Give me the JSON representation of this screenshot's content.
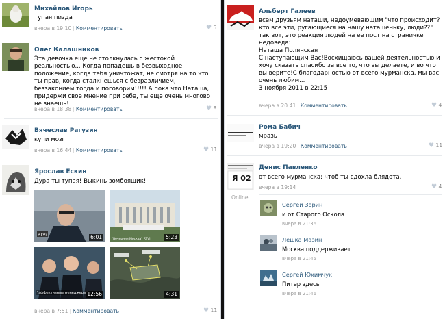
{
  "left": {
    "posts": [
      {
        "author": "Михайлов Игорь",
        "text": "тупая пизда",
        "time": "вчера в 19:10",
        "comment": "Комментировать",
        "likes": "5"
      },
      {
        "author": "Олег Калашников",
        "text": "Эта девочка еще не столкнулась с жестокой реальностью... Когда попадешь в безвыходное положение, когда тебя уничтожат, не смотря на то что ты прав, когда сталкнешься с безразличием, беззаконием тогда и поговорим!!!!! А пока что Наташа, придержи свое мнение при себе, ты еще очень многово не знаешь!",
        "time": "вчера в 18:38",
        "comment": "Комментировать",
        "likes": "8"
      },
      {
        "author": "Вячеслав Рагузин",
        "text": "купи мозг",
        "time": "вчера в 16:44",
        "comment": "Комментировать",
        "likes": "11"
      },
      {
        "author": "Ярослав Ескин",
        "text": "Дура ты тупая! Выкинь зомбоящик!",
        "time": "вчера в 7:51",
        "comment": "Комментировать",
        "likes": "11",
        "videos": [
          {
            "duration": "6:01",
            "caption": "RTVi"
          },
          {
            "duration": "5:23",
            "caption": "\"Вечерняя Москва\" RTVi"
          },
          {
            "duration": "12:56",
            "caption": "\"эффективные менеджеры\""
          },
          {
            "duration": "4:31",
            "caption": ""
          }
        ]
      }
    ]
  },
  "right": {
    "posts": [
      {
        "author": "Альберт Галеев",
        "text_lines": [
          "всем друзьям наташи, недоумевающим \"что происходит? кто все эти, ругающиеся на нашу наташеньку, люди??\"",
          "так вот, это реакция людей на ее пост на страничке недоведа:",
          "Наташа Полянская",
          "С наступающим Вас!Восхищаюсь вашей деятельностью и хочу сказать спасибо за все то, что вы делаете, и во что вы верите!С благодарностью от всего мурманска, мы вас очень любим...",
          "3 ноября 2011 в 22:15"
        ],
        "time": "вчера в 20:41",
        "comment": "Комментировать",
        "likes": "4"
      },
      {
        "author": "Рома Бабич",
        "text": "мразь",
        "time": "вчера в 19:20",
        "comment": "Комментировать",
        "likes": "11"
      },
      {
        "author": "Денис Павленко",
        "text": "от всего мурманска: чтоб ты сдохла блядота.",
        "time": "вчера в 19:14",
        "likes": "4",
        "online": "Online",
        "avatar_text": "Я 02",
        "replies": [
          {
            "author": "Сергей Зорин",
            "text": "и от Старого Оскола",
            "time": "вчера в 21:36"
          },
          {
            "author": "Лешка Мазин",
            "text": "Москва поддерживает",
            "time": "вчера в 21:45"
          },
          {
            "author": "Сергей Юхимчук",
            "text": "Питер здесь",
            "time": "вчера в 21:46"
          }
        ]
      }
    ]
  }
}
